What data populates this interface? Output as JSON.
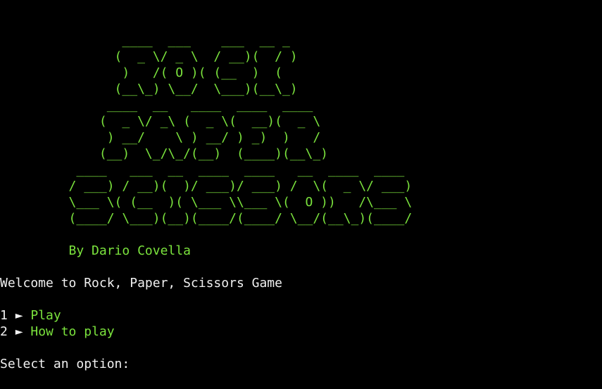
{
  "ascii_art": {
    "rock": [
      "                ____  ___    ___  __ _ ",
      "               (  _ \\/ _ \\  / __)(  / )",
      "                )   /( O )( (__  )  ( ",
      "               (__\\_) \\__/  \\___)(__\\_)",
      ""
    ],
    "paper": [
      "              ____  __   ____  ____  ____ ",
      "             (  _ \\/ _\\ (  _ \\(  __)(  _ \\",
      "              ) __/    \\ ) __/ ) _)  )   /",
      "             (__)  \\_/\\_/(__)  (____)(__\\_)",
      ""
    ],
    "scissors": [
      "          ____   ___  __  ____  ____   __  ____  ____ ",
      "         / ___) / __)(  )/ ___)/ ___) /  \\(  _ \\/ ___)",
      "         \\___ \\( (__  )( \\___ \\\\___ \\(  O ))   /\\___ \\",
      "         (____/ \\___)(__)(____/(____/ \\__/(__\\_)(____/",
      ""
    ]
  },
  "author": "         By Dario Covella",
  "welcome": "Welcome to Rock, Paper, Scissors Game",
  "menu": [
    {
      "number": "1",
      "arrow": "►",
      "label": "Play"
    },
    {
      "number": "2",
      "arrow": "►",
      "label": "How to play"
    }
  ],
  "prompt": "Select an option:"
}
